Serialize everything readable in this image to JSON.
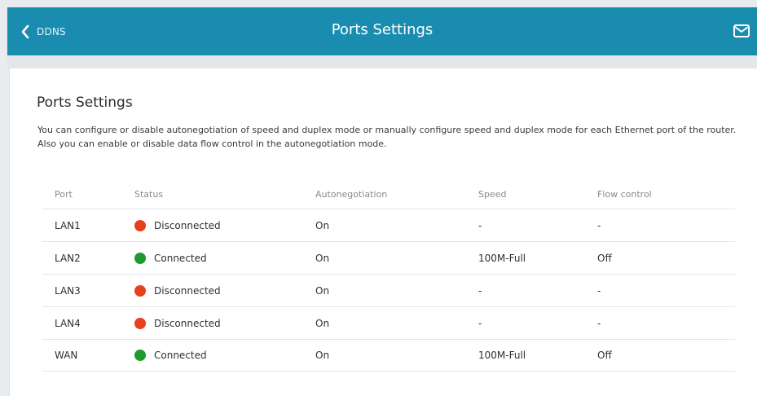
{
  "header": {
    "back_label": "DDNS",
    "title": "Ports Settings"
  },
  "page": {
    "title": "Ports Settings",
    "description": "You can configure or disable autonegotiation of speed and duplex mode or manually configure speed and duplex mode for each Ethernet port of the router. Also you can enable or disable data flow control in the autonegotiation mode."
  },
  "table": {
    "columns": [
      "Port",
      "Status",
      "Autonegotiation",
      "Speed",
      "Flow control"
    ],
    "rows": [
      {
        "port": "LAN1",
        "status": "Disconnected",
        "status_color": "#e8401c",
        "autoneg": "On",
        "speed": "-",
        "flow": "-"
      },
      {
        "port": "LAN2",
        "status": "Connected",
        "status_color": "#1f9a2e",
        "autoneg": "On",
        "speed": "100M-Full",
        "flow": "Off"
      },
      {
        "port": "LAN3",
        "status": "Disconnected",
        "status_color": "#e8401c",
        "autoneg": "On",
        "speed": "-",
        "flow": "-"
      },
      {
        "port": "LAN4",
        "status": "Disconnected",
        "status_color": "#e8401c",
        "autoneg": "On",
        "speed": "-",
        "flow": "-"
      },
      {
        "port": "WAN",
        "status": "Connected",
        "status_color": "#1f9a2e",
        "autoneg": "On",
        "speed": "100M-Full",
        "flow": "Off"
      }
    ]
  },
  "colors": {
    "header_bg": "#1a8cb0",
    "connected": "#1f9a2e",
    "disconnected": "#e8401c"
  },
  "icons": {
    "back": "chevron-left-icon",
    "mail": "envelope-icon"
  }
}
